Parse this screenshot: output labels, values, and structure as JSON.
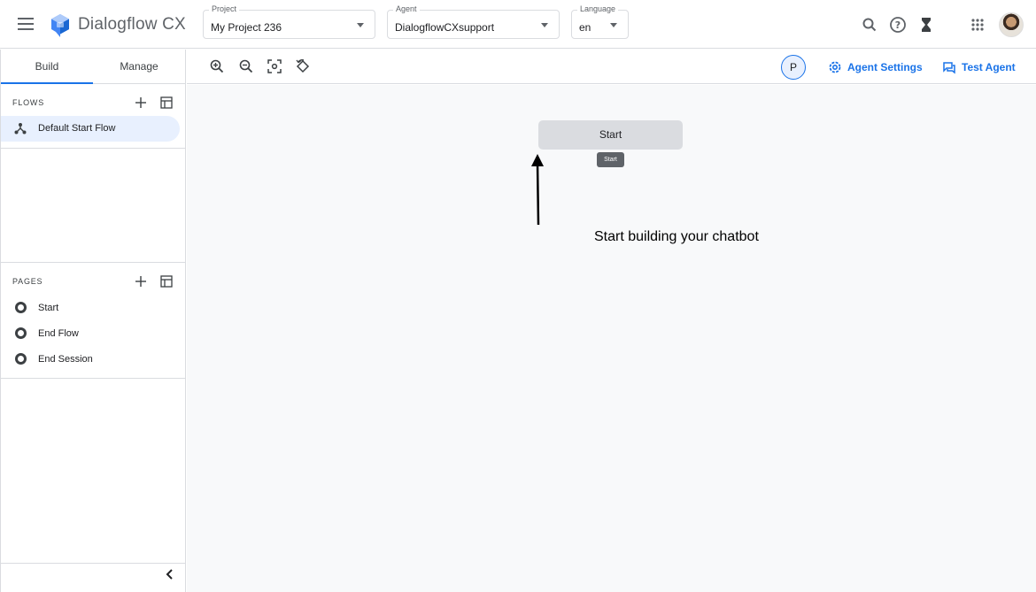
{
  "app": {
    "title": "Dialogflow CX"
  },
  "selectors": {
    "project": {
      "label": "Project",
      "value": "My Project 236"
    },
    "agent": {
      "label": "Agent",
      "value": "DialogflowCXsupport"
    },
    "language": {
      "label": "Language",
      "value": "en"
    }
  },
  "icons": {
    "menu": "hamburger-icon",
    "search": "search-icon",
    "help": "help-icon",
    "history": "hourglass-icon",
    "apps": "apps-grid-icon",
    "zoom_in": "zoom-in-icon",
    "zoom_out": "zoom-out-icon",
    "fit": "fit-to-screen-icon",
    "reset": "reset-view-icon",
    "settings": "gear-icon",
    "test": "chat-icon"
  },
  "sidebar": {
    "tabs": [
      {
        "label": "Build"
      },
      {
        "label": "Manage"
      }
    ],
    "flows": {
      "title": "FLOWS",
      "items": [
        {
          "label": "Default Start Flow"
        }
      ]
    },
    "pages": {
      "title": "PAGES",
      "items": [
        {
          "label": "Start"
        },
        {
          "label": "End Flow"
        },
        {
          "label": "End Session"
        }
      ]
    }
  },
  "toolbar": {
    "avatar_initial": "P",
    "agent_settings_label": "Agent Settings",
    "test_agent_label": "Test Agent"
  },
  "canvas": {
    "start_node_label": "Start",
    "start_chip_label": "Start",
    "hint_text": "Start building your chatbot"
  },
  "colors": {
    "accent": "#1a73e8",
    "selected_bg": "#e8f0fe",
    "canvas_bg": "#f8f9fa",
    "node_bg": "#dadce0"
  }
}
